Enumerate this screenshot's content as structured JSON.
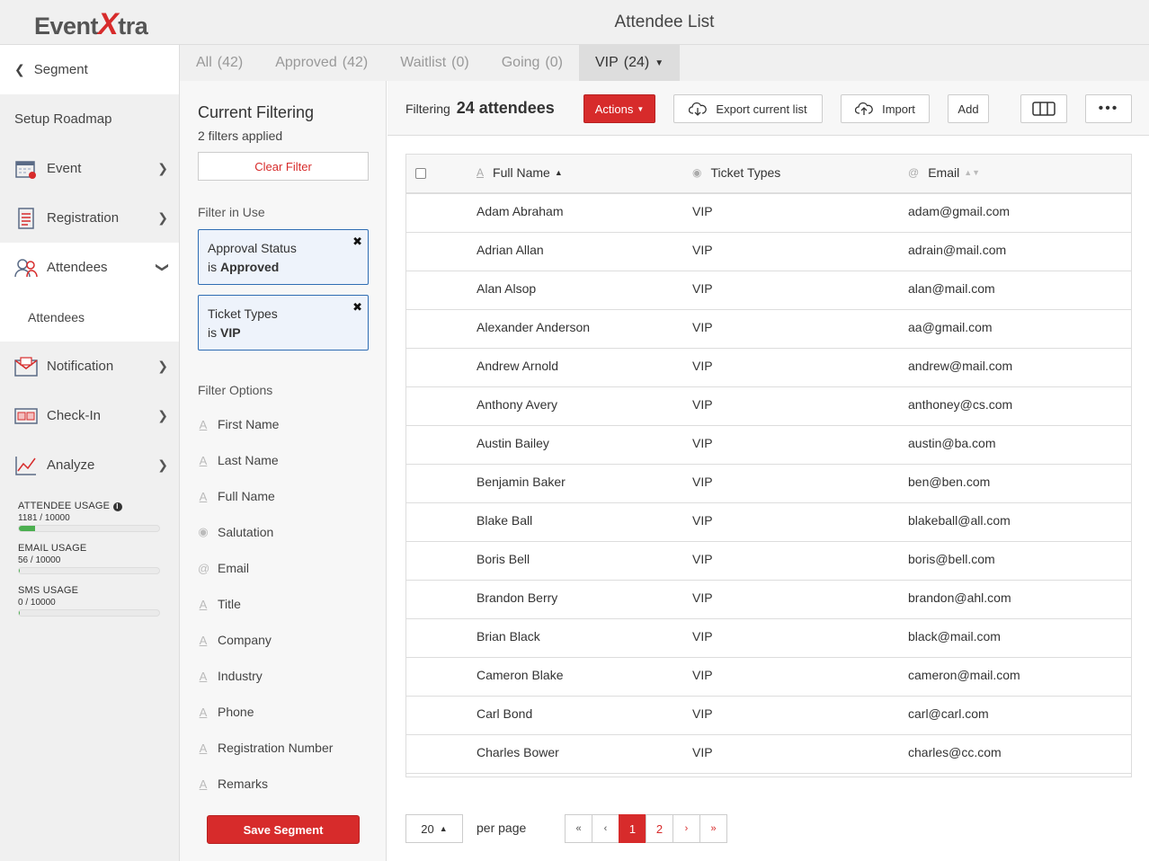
{
  "app": {
    "logo_prefix": "Event",
    "logo_x": "X",
    "logo_suffix": "tra",
    "title": "Attendee List"
  },
  "sidebar": {
    "back_label": "Segment",
    "roadmap": "Setup Roadmap",
    "items": [
      {
        "label": "Event",
        "icon": "calendar-icon"
      },
      {
        "label": "Registration",
        "icon": "form-icon"
      },
      {
        "label": "Attendees",
        "icon": "people-icon"
      },
      {
        "label": "Notification",
        "icon": "envelope-icon"
      },
      {
        "label": "Check-In",
        "icon": "ticket-icon"
      },
      {
        "label": "Analyze",
        "icon": "chart-icon"
      }
    ],
    "sub_item": "Attendees",
    "usage": [
      {
        "label": "ATTENDEE USAGE",
        "value": "1181 / 10000",
        "fraction": 0.1181
      },
      {
        "label": "EMAIL USAGE",
        "value": "56 / 10000",
        "fraction": 0.0056
      },
      {
        "label": "SMS USAGE",
        "value": "0 / 10000",
        "fraction": 0
      }
    ]
  },
  "tabs": [
    {
      "label": "All",
      "count": "(42)"
    },
    {
      "label": "Approved",
      "count": "(42)"
    },
    {
      "label": "Waitlist",
      "count": "(0)"
    },
    {
      "label": "Going",
      "count": "(0)"
    },
    {
      "label": "VIP",
      "count": "(24)"
    }
  ],
  "filters": {
    "title": "Current Filtering",
    "applied": "2 filters applied",
    "clear": "Clear Filter",
    "in_use_title": "Filter in Use",
    "chips": [
      {
        "field": "Approval Status",
        "op": "is",
        "value": "Approved"
      },
      {
        "field": "Ticket Types",
        "op": "is",
        "value": "VIP"
      }
    ],
    "options_title": "Filter Options",
    "options": [
      {
        "label": "First Name",
        "icon": "A"
      },
      {
        "label": "Last Name",
        "icon": "A"
      },
      {
        "label": "Full Name",
        "icon": "A"
      },
      {
        "label": "Salutation",
        "icon": "◉"
      },
      {
        "label": "Email",
        "icon": "@"
      },
      {
        "label": "Title",
        "icon": "A"
      },
      {
        "label": "Company",
        "icon": "A"
      },
      {
        "label": "Industry",
        "icon": "A"
      },
      {
        "label": "Phone",
        "icon": "A"
      },
      {
        "label": "Registration Number",
        "icon": "A"
      },
      {
        "label": "Remarks",
        "icon": "A"
      }
    ],
    "save": "Save Segment"
  },
  "toolbar": {
    "filtering_label": "Filtering",
    "filtering_count": "24 attendees",
    "actions": "Actions",
    "export": "Export current list",
    "import": "Import",
    "add": "Add",
    "more": "•••"
  },
  "table": {
    "headers": {
      "name": "Full Name",
      "type": "Ticket Types",
      "email": "Email"
    },
    "rows": [
      {
        "name": "Adam Abraham",
        "type": "VIP",
        "email": "adam@gmail.com"
      },
      {
        "name": "Adrian Allan",
        "type": "VIP",
        "email": "adrain@mail.com"
      },
      {
        "name": "Alan Alsop",
        "type": "VIP",
        "email": "alan@mail.com"
      },
      {
        "name": "Alexander Anderson",
        "type": "VIP",
        "email": "aa@gmail.com"
      },
      {
        "name": "Andrew Arnold",
        "type": "VIP",
        "email": "andrew@mail.com"
      },
      {
        "name": "Anthony Avery",
        "type": "VIP",
        "email": "anthoney@cs.com"
      },
      {
        "name": "Austin Bailey",
        "type": "VIP",
        "email": "austin@ba.com"
      },
      {
        "name": "Benjamin Baker",
        "type": "VIP",
        "email": "ben@ben.com"
      },
      {
        "name": "Blake Ball",
        "type": "VIP",
        "email": "blakeball@all.com"
      },
      {
        "name": "Boris Bell",
        "type": "VIP",
        "email": "boris@bell.com"
      },
      {
        "name": "Brandon Berry",
        "type": "VIP",
        "email": "brandon@ahl.com"
      },
      {
        "name": "Brian Black",
        "type": "VIP",
        "email": "black@mail.com"
      },
      {
        "name": "Cameron Blake",
        "type": "VIP",
        "email": "cameron@mail.com"
      },
      {
        "name": "Carl Bond",
        "type": "VIP",
        "email": "carl@carl.com"
      },
      {
        "name": "Charles Bower",
        "type": "VIP",
        "email": "charles@cc.com"
      }
    ]
  },
  "pager": {
    "per_page_value": "20",
    "per_page_label": "per page",
    "first": "«",
    "prev": "‹",
    "pages": [
      "1",
      "2"
    ],
    "next": "›",
    "last": "»"
  },
  "colors": {
    "accent": "#d72b2b",
    "chip_border": "#2f6db3",
    "usage_fill": "#4caf50"
  }
}
